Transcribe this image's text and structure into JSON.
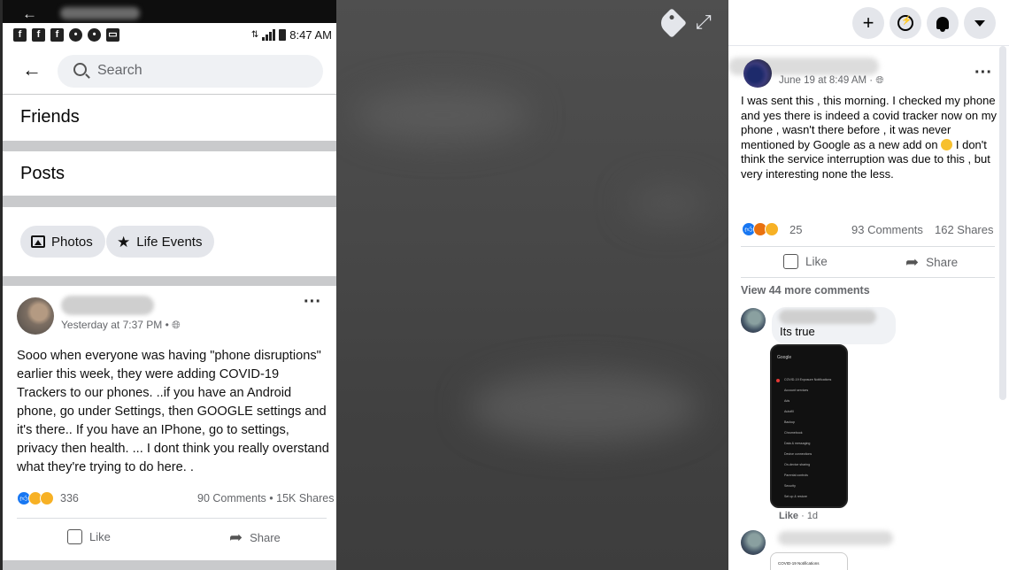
{
  "phone": {
    "status_time": "8:47 AM",
    "search_placeholder": "Search",
    "menu": {
      "friends": "Friends",
      "posts": "Posts"
    },
    "chips": {
      "photos": "Photos",
      "life_events": "Life Events"
    },
    "post": {
      "timestamp": "Yesterday at 7:37 PM •",
      "text": "Sooo when everyone was having \"phone disruptions\" earlier this week, they were adding COVID-19 Trackers to our phones. ..if you have an Android phone, go under Settings, then GOOGLE settings and it's there.. If you have an IPhone, go to settings, privacy then health. ... I dont think you really overstand what they're trying to do here. .",
      "reaction_count": "336",
      "comments_shares": "90 Comments • 15K Shares",
      "like_label": "Like",
      "share_label": "Share"
    }
  },
  "viewer": {
    "tag_icon": "tag-icon",
    "expand_icon": "expand-icon"
  },
  "panel": {
    "topbar_icons": [
      "plus-icon",
      "messenger-icon",
      "notifications-icon",
      "caret-down-icon"
    ],
    "post": {
      "timestamp": "June 19 at 8:49 AM ·",
      "text_part1": "I was sent this , this morning. I checked my phone and yes there is indeed a covid tracker now on my phone , wasn't there before , it was never mentioned by Google as a new add on",
      "text_part2": "I don't think the service interruption was due to this , but very interesting none the less.",
      "reaction_count": "25",
      "comments": "93 Comments",
      "shares": "162 Shares",
      "like_label": "Like",
      "share_label": "Share"
    },
    "view_more": "View 44 more comments",
    "comment": {
      "text": "Its true",
      "like_label": "Like",
      "age": "1d"
    },
    "screenshot": {
      "header": "Google",
      "items": [
        "COVID-19 Exposure Notifications",
        "Account services",
        "Ads",
        "Autofill",
        "Backup",
        "Chromebook",
        "Data & messaging",
        "Device connections",
        "On-device sharing",
        "Parental controls",
        "Security",
        "Set up & restore"
      ]
    },
    "screenshot2_title": "COVID-19 Notifications"
  }
}
